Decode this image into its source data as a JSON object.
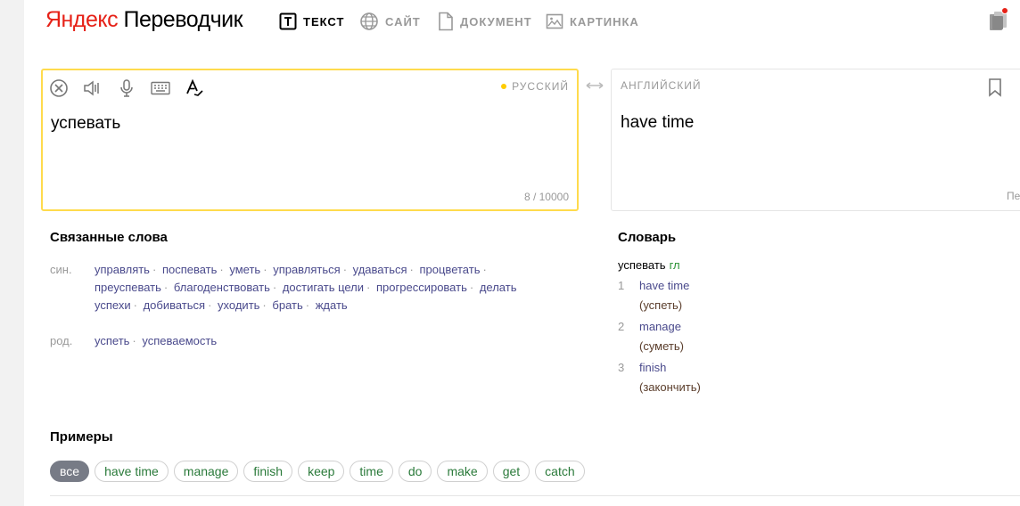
{
  "header": {
    "logo_brand": "Яндекс",
    "logo_product": "Переводчик",
    "tabs": [
      {
        "label": "ТЕКСТ",
        "icon": "text-icon",
        "active": true
      },
      {
        "label": "САЙТ",
        "icon": "globe-icon",
        "active": false
      },
      {
        "label": "ДОКУМЕНТ",
        "icon": "document-icon",
        "active": false
      },
      {
        "label": "КАРТИНКА",
        "icon": "image-icon",
        "active": false
      }
    ]
  },
  "source": {
    "language": "РУССКИЙ",
    "text": "успевать",
    "counter": "8 / 10000"
  },
  "target": {
    "language": "АНГЛИЙСКИЙ",
    "text": "have time",
    "cut_text": "Пе"
  },
  "related": {
    "title": "Связанные слова",
    "syn_label": "син.",
    "synonyms": [
      "управлять",
      "поспевать",
      "уметь",
      "управляться",
      "удаваться",
      "процветать",
      "преуспевать",
      "благоденствовать",
      "достигать цели",
      "прогрессировать",
      "делать успехи",
      "добиваться",
      "уходить",
      "брать",
      "ждать"
    ],
    "rod_label": "род.",
    "related_words": [
      "успеть",
      "успеваемость"
    ]
  },
  "dictionary": {
    "title": "Словарь",
    "word": "успевать",
    "pos": "гл",
    "entries": [
      {
        "num": "1",
        "translation": "have time",
        "example": "(успеть)"
      },
      {
        "num": "2",
        "translation": "manage",
        "example": "(суметь)"
      },
      {
        "num": "3",
        "translation": "finish",
        "example": "(закончить)"
      }
    ]
  },
  "examples": {
    "title": "Примеры",
    "chips": [
      "все",
      "have time",
      "manage",
      "finish",
      "keep",
      "time",
      "do",
      "make",
      "get",
      "catch"
    ]
  },
  "colors": {
    "accent_yellow": "#ffdb4d",
    "brand_red": "#e62117",
    "link": "#4a4a8c",
    "pos_green": "#2a9134"
  }
}
